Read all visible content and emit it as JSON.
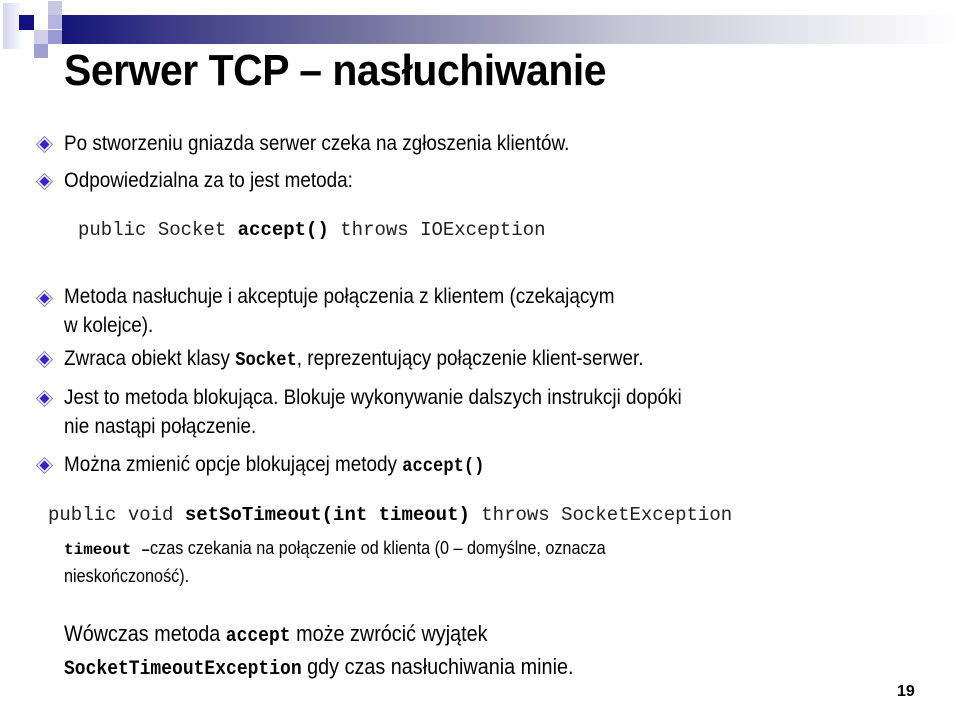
{
  "slide": {
    "title": "Serwer TCP – nasłuchiwanie",
    "accent_color": "#141478",
    "bullet_color": "#3a22c0",
    "page_number": "19"
  },
  "bullets": [
    {
      "icon": "diamond-bullet-icon",
      "text": "Po stworzeniu gniazda serwer czeka na zgłoszenia klientów."
    },
    {
      "icon": "diamond-bullet-icon",
      "text": "Odpowiedzialna za to jest metoda:"
    },
    {
      "icon": "diamond-bullet-icon",
      "text_line1": "Metoda nasłuchuje i akceptuje połączenia z klientem (czekającym",
      "text_line2": "w kolejce)."
    },
    {
      "icon": "diamond-bullet-icon",
      "pre": "Zwraca obiekt klasy ",
      "code": "Socket",
      "post": ", reprezentujący połączenie klient-serwer."
    },
    {
      "icon": "diamond-bullet-icon",
      "text_line1": "Jest to metoda blokująca. Blokuje wykonywanie dalszych instrukcji dopóki",
      "text_line2": "nie nastąpi połączenie."
    },
    {
      "icon": "diamond-bullet-icon",
      "pre": "Można zmienić opcje blokującej metody ",
      "code": "accept()"
    }
  ],
  "signature_accept": {
    "pre": "public Socket ",
    "method": "accept()",
    "post": " throws IOException"
  },
  "signature_timeout": {
    "pre": "public void ",
    "method": "setSoTimeout(int timeout)",
    "post": " throws SocketException"
  },
  "param_note": {
    "param": "timeout –",
    "line1": " czas czekania na połączenie od klienta (0 – domyślne, oznacza",
    "line2": "nieskończoność)."
  },
  "closing": {
    "pre": "Wówczas metoda ",
    "code": "accept",
    "post": " może zwrócić wyjątek",
    "code2": "SocketTimeoutException",
    "post2": " gdy czas nasłuchiwania minie."
  }
}
